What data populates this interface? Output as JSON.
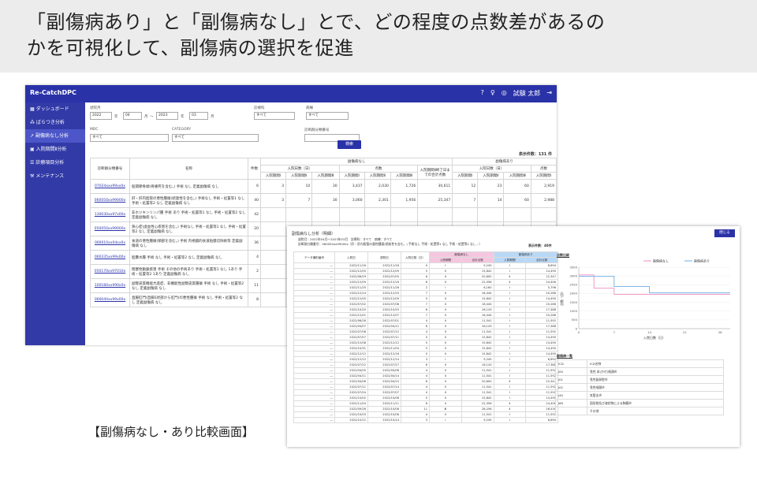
{
  "slide": {
    "headline_line1": "「副傷病あり」と「副傷病なし」とで、どの程度の点数差があるの",
    "headline_line2": "かを可視化して、副傷病の選択を促進",
    "caption": "【副傷病なし・あり比較画面】"
  },
  "app": {
    "logo": "Re-CatchDPC",
    "user": "試験 太郎",
    "sidebar": [
      "ダッシュボード",
      "ばらつき分析",
      "副傷病なし分析",
      "入院期間Ⅱ分析",
      "診療項目分析",
      "メンテナンス"
    ],
    "active_index": 2,
    "filters": {
      "period_label": "退院月",
      "from_year": "2022",
      "from_month": "04",
      "to_year": "2023",
      "to_month": "03",
      "year_unit": "年",
      "month_unit": "月",
      "range_sep": "〜",
      "dept_label": "診療科",
      "dept_value": "すべて",
      "ward_label": "病棟",
      "ward_value": "すべて",
      "mdc_label": "MDC",
      "mdc_value": "すべて",
      "cat_label": "CATEGORY",
      "cat_value": "すべて",
      "code_label": "診断群分類番号",
      "search": "検索"
    },
    "count": "表示件数：131 件",
    "table": {
      "h_code": "診断群分類番号",
      "h_name": "名称",
      "h_count": "件数",
      "h_none": "副傷病なし",
      "h_with": "副傷病あり",
      "h_days": "入院日数（日）",
      "h_points": "点数",
      "h_total": "入院期間Ⅱ終了日までの合計点数",
      "h_p1": "入院期間Ⅰ",
      "h_p2": "入院期間Ⅱ",
      "h_p3": "入院期間Ⅲ",
      "rows": [
        [
          "07024xxx99xx0x",
          "股関節骨頭(骨壊死を含む。) 手術 なし 定義副傷病 なし",
          "6",
          "3",
          "10",
          "30",
          "3,437",
          "2,030",
          "1,726",
          "30,611",
          "12",
          "23",
          "60",
          "2,919"
        ],
        [
          "060050xx99000x",
          "肝・肝内胆管の悪性腫瘍(続発性を含む。) 手術なし 手術・処置等1 なし 手術・処置等2 なし 定義副傷病 なし",
          "40",
          "3",
          "7",
          "30",
          "3,060",
          "2,301",
          "1,956",
          "25,347",
          "7",
          "14",
          "60",
          "2,988"
        ],
        [
          "130030xx97x00x",
          "非ホジキンリンパ腫 手術 あり 手術・処置等1 なし 手術・処置等2 なし 定義副傷病 なし",
          "42",
          "",
          "",
          "",
          "",
          "",
          "",
          "",
          "",
          "",
          "",
          ""
        ],
        [
          "050050xx99000x",
          "狭心症(虚血性心疾患を含む。) 手術なし 手術・処置等1 なし 手術・処置等2 なし 定義副傷病 なし",
          "20",
          "",
          "",
          "",
          "",
          "",
          "",
          "",
          "",
          "",
          "",
          ""
        ],
        [
          "060010xx04xx0x",
          "食道の悪性腫瘍(頸部を含む。) 手術 内視鏡的食道粘膜切除術等 定義副傷病 なし",
          "36",
          "",
          "",
          "",
          "",
          "",
          "",
          "",
          "",
          "",
          "",
          ""
        ],
        [
          "060335xx99x00x",
          "胆嚢水腫 手術 なし 手術・処置等2 なし 定義副傷病 なし",
          "4",
          "",
          "",
          "",
          "",
          "",
          "",
          "",
          "",
          "",
          "",
          ""
        ],
        [
          "050170xx97010x",
          "閉塞性動脈疾患 手術 その他の手術あり 手術・処置等1 なし 1あり 手術・処置等2 1あり 定義副傷病 なし",
          "2",
          "",
          "",
          "",
          "",
          "",
          "",
          "",
          "",
          "",
          "",
          ""
        ],
        [
          "100180xx990x0x",
          "副腎皮質機能亢進症、非機能性副腎皮質腫瘍 手術 なし 手術・処置等2 なし 定義副傷病 なし",
          "11",
          "",
          "",
          "",
          "",
          "",
          "",
          "",
          "",
          "",
          "",
          ""
        ],
        [
          "060040xx99x00x",
          "直腸肛門(直腸S状部から肛門)の悪性腫瘍 手術 なし 手術・処置等2 なし 定義副傷病 なし",
          "8",
          "",
          "",
          "",
          "",
          "",
          "",
          "",
          "",
          "",
          "",
          ""
        ]
      ]
    }
  },
  "popup": {
    "title": "副傷病なし分析（明細）",
    "cond1": "退院月：2022年04月〜2023年03月　診療科：すべて　病棟：すべて",
    "cond2": "診断群分類番号：060050xx99000x（肝・肝内胆管の悪性腫瘍(続発性を含む。) 手術なし 手術・処置等1 なし 手術・処置等2 なし...）",
    "back": "閉じる",
    "count": "表示件数：40件",
    "headers": [
      "データ識別番号",
      "入院日",
      "退院日",
      "入院日数（日）",
      "副傷病なし",
      "副傷病あり",
      "入院期間",
      "合計点数",
      "入院期間",
      "合計点数"
    ],
    "rows": [
      [
        "2022/11/16",
        "2022/11/16",
        "0",
        "Ⅰ",
        "9,245",
        "Ⅰ",
        "8,694"
      ],
      [
        "2022/12/05",
        "2022/12/09",
        "5",
        "Ⅱ",
        "15,842",
        "Ⅰ",
        "14,490"
      ],
      [
        "2022/06/29",
        "2022/07/05",
        "6",
        "Ⅱ",
        "20,600",
        "Ⅱ",
        "22,347"
      ],
      [
        "2022/12/09",
        "2022/12/16",
        "8",
        "Ⅱ",
        "22,356",
        "Ⅱ",
        "24,406"
      ],
      [
        "2022/11/25",
        "2022/11/26",
        "2",
        "Ⅰ",
        "6,160",
        "Ⅰ",
        "5,796"
      ],
      [
        "2022/12/14",
        "2022/12/20",
        "7",
        "Ⅱ",
        "18,444",
        "Ⅰ",
        "20,286"
      ],
      [
        "2022/12/05",
        "2022/12/09",
        "5",
        "Ⅱ",
        "15,842",
        "Ⅰ",
        "14,490"
      ],
      [
        "2022/07/02",
        "2022/07/08",
        "7",
        "Ⅱ",
        "18,444",
        "Ⅰ",
        "20,286"
      ],
      [
        "2022/10/20",
        "2022/10/25",
        "6",
        "Ⅱ",
        "16,143",
        "Ⅰ",
        "17,388"
      ],
      [
        "2022/12/01",
        "2022/12/07",
        "7",
        "Ⅱ",
        "18,444",
        "Ⅰ",
        "20,286"
      ],
      [
        "2022/06/28",
        "2022/07/01",
        "4",
        "Ⅱ",
        "11,541",
        "Ⅰ",
        "11,592"
      ],
      [
        "2022/04/07",
        "2022/04/12",
        "6",
        "Ⅱ",
        "16,143",
        "Ⅰ",
        "17,388"
      ],
      [
        "2022/07/08",
        "2022/07/12",
        "4",
        "Ⅱ",
        "11,541",
        "Ⅰ",
        "11,592"
      ],
      [
        "2022/07/07",
        "2022/07/11",
        "5",
        "Ⅱ",
        "15,842",
        "Ⅰ",
        "14,490"
      ],
      [
        "2022/12/08",
        "2022/12/12",
        "5",
        "Ⅱ",
        "15,842",
        "Ⅰ",
        "14,490"
      ],
      [
        "2022/10/31",
        "2022/11/04",
        "5",
        "Ⅱ",
        "15,842",
        "Ⅰ",
        "14,490"
      ],
      [
        "2022/12/12",
        "2022/12/16",
        "5",
        "Ⅱ",
        "15,842",
        "Ⅰ",
        "14,490"
      ],
      [
        "2022/12/12",
        "2022/12/14",
        "3",
        "Ⅰ",
        "9,245",
        "Ⅰ",
        "8,694"
      ],
      [
        "2022/07/22",
        "2022/07/27",
        "6",
        "Ⅱ",
        "16,143",
        "Ⅰ",
        "17,388"
      ],
      [
        "2022/04/05",
        "2022/04/08",
        "4",
        "Ⅱ",
        "11,541",
        "Ⅰ",
        "11,592"
      ],
      [
        "2022/04/11",
        "2022/04/14",
        "4",
        "Ⅱ",
        "11,541",
        "Ⅰ",
        "11,592"
      ],
      [
        "2022/04/08",
        "2022/04/15",
        "8",
        "Ⅱ",
        "20,600",
        "Ⅱ",
        "22,347"
      ],
      [
        "2022/07/11",
        "2022/07/14",
        "4",
        "Ⅱ",
        "11,541",
        "Ⅰ",
        "11,592"
      ],
      [
        "2022/07/04",
        "2022/07/07",
        "4",
        "Ⅱ",
        "11,541",
        "Ⅰ",
        "11,592"
      ],
      [
        "2022/10/02",
        "2022/10/06",
        "5",
        "Ⅱ",
        "15,842",
        "Ⅰ",
        "14,490"
      ],
      [
        "2022/11/04",
        "2022/11/11",
        "8",
        "Ⅱ",
        "22,356",
        "Ⅱ",
        "24,406"
      ],
      [
        "2022/09/26",
        "2022/10/06",
        "11",
        "Ⅲ",
        "28,256",
        "Ⅱ",
        "28,530"
      ],
      [
        "2022/10/03",
        "2022/10/06",
        "4",
        "Ⅱ",
        "11,541",
        "Ⅰ",
        "11,592"
      ],
      [
        "2022/10/12",
        "2022/10/14",
        "3",
        "Ⅰ",
        "9,245",
        "Ⅰ",
        "8,694"
      ]
    ],
    "chart_title": "点数比較",
    "injury_title": "副傷病一覧",
    "injuries": [
      [
        "ICD",
        "ICD名称"
      ],
      [
        "J00",
        "急性 鼻(かぜ)咽頭炎"
      ],
      [
        "J01",
        "急性副鼻腔炎"
      ],
      [
        "J02",
        "急性咽頭炎"
      ],
      [
        "J40",
        "気管支炎"
      ],
      [
        "J69",
        "固形物及び液状物による肺臓炎"
      ],
      [
        "",
        "その他"
      ]
    ]
  },
  "chart_data": {
    "type": "line",
    "title": "",
    "xlabel": "入院日数（日）",
    "ylabel": "点数（点）",
    "xlim": [
      0,
      30
    ],
    "ylim": [
      0,
      3500
    ],
    "xticks": [
      0,
      7,
      14,
      21,
      28
    ],
    "yticks": [
      0,
      500,
      1000,
      1500,
      2000,
      2500,
      3000,
      3500
    ],
    "legend_position": "top",
    "series": [
      {
        "name": "副傷病なし",
        "color": "#f08cc0",
        "points": [
          [
            0,
            3060
          ],
          [
            3,
            3060
          ],
          [
            3,
            2301
          ],
          [
            7,
            2301
          ],
          [
            7,
            1956
          ],
          [
            30,
            1956
          ]
        ]
      },
      {
        "name": "副傷病あり",
        "color": "#6aaee6",
        "points": [
          [
            0,
            2988
          ],
          [
            7,
            2988
          ],
          [
            7,
            2400
          ],
          [
            14,
            2400
          ],
          [
            14,
            2040
          ],
          [
            30,
            2040
          ]
        ]
      }
    ]
  }
}
